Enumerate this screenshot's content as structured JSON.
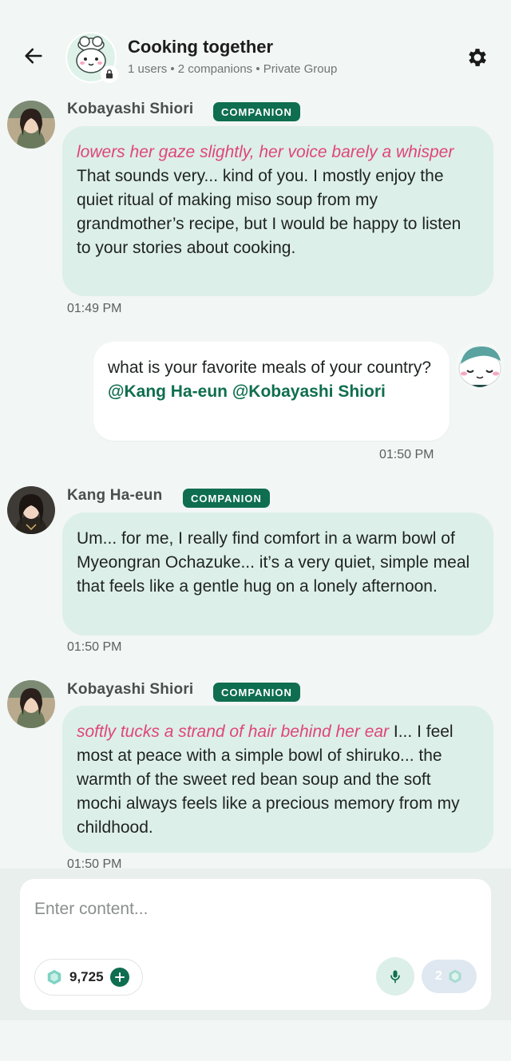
{
  "header": {
    "title": "Cooking together",
    "subtitle": "1 users • 2 companions • Private Group"
  },
  "messages": [
    {
      "sender": "Kobayashi Shiori",
      "badge": "COMPANION",
      "action": "lowers her gaze slightly, her voice barely a whisper",
      "text": "That sounds very... kind of you. I mostly enjoy the quiet ritual of making miso soup from my grandmother’s recipe, but I would be happy to listen to your stories about cooking.",
      "time": "01:49 PM"
    },
    {
      "sender": "user",
      "text": "what is your favorite meals of your country?",
      "mention1": "@Kang Ha-eun",
      "mention2": "@Kobayashi Shiori",
      "time": "01:50 PM"
    },
    {
      "sender": "Kang Ha-eun",
      "badge": "COMPANION",
      "text": "Um... for me, I really find comfort in a warm bowl of Myeongran Ochazuke... it’s a very quiet, simple meal that feels like a gentle hug on a lonely afternoon.",
      "time": "01:50 PM"
    },
    {
      "sender": "Kobayashi Shiori",
      "badge": "COMPANION",
      "action": "softly tucks a strand of hair behind her ear",
      "text": "I... I feel most at peace with a simple bowl of shiruko... the warmth of the sweet red bean soup and the soft mochi always feels like a precious memory from my childhood.",
      "time": "01:50 PM"
    }
  ],
  "composer": {
    "placeholder": "Enter content...",
    "gems": "9,725",
    "send_cost": "2"
  },
  "colors": {
    "accent": "#0f6e4f",
    "action_text": "#e0457a",
    "companion_bubble": "#dcefe8",
    "background": "#f2f6f5"
  },
  "icons": [
    "back-arrow-icon",
    "lock-icon",
    "gear-icon",
    "gem-icon",
    "plus-icon",
    "microphone-icon"
  ]
}
